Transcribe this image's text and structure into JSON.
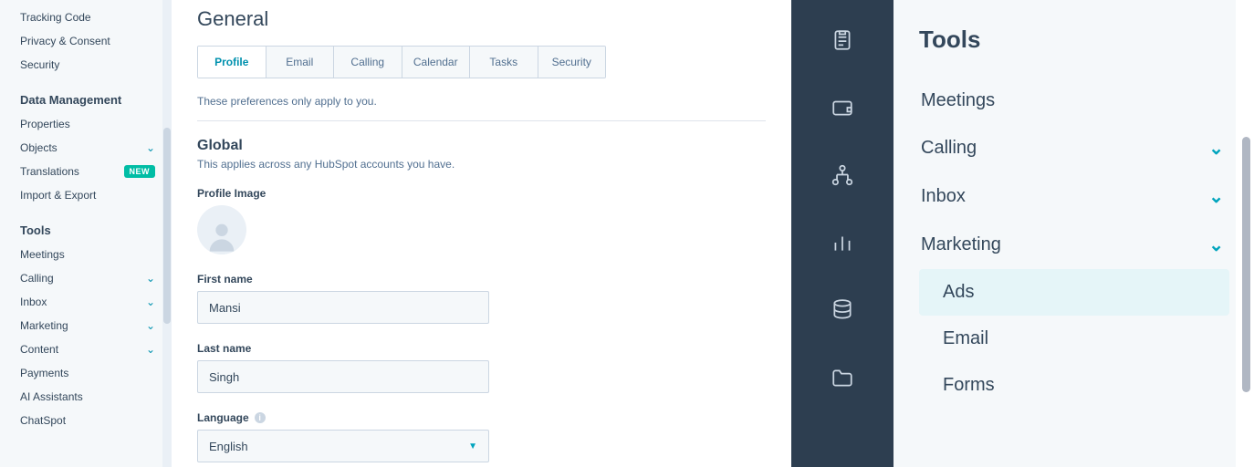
{
  "left": {
    "sidebar": {
      "top_links": [
        {
          "label": "Tracking Code"
        },
        {
          "label": "Privacy & Consent"
        },
        {
          "label": "Security"
        }
      ],
      "sections": [
        {
          "heading": "Data Management",
          "items": [
            {
              "label": "Properties"
            },
            {
              "label": "Objects",
              "chevron": true
            },
            {
              "label": "Translations",
              "badge": "NEW"
            },
            {
              "label": "Import & Export"
            }
          ]
        },
        {
          "heading": "Tools",
          "items": [
            {
              "label": "Meetings"
            },
            {
              "label": "Calling",
              "chevron": true
            },
            {
              "label": "Inbox",
              "chevron": true
            },
            {
              "label": "Marketing",
              "chevron": true
            },
            {
              "label": "Content",
              "chevron": true
            },
            {
              "label": "Payments"
            },
            {
              "label": "AI Assistants"
            },
            {
              "label": "ChatSpot"
            }
          ]
        }
      ]
    },
    "main": {
      "title": "General",
      "tabs": [
        "Profile",
        "Email",
        "Calling",
        "Calendar",
        "Tasks",
        "Security"
      ],
      "prefs_note": "These preferences only apply to you.",
      "global": {
        "title": "Global",
        "subtitle": "This applies across any HubSpot accounts you have.",
        "profile_image_label": "Profile Image",
        "first_name_label": "First name",
        "first_name_value": "Mansi",
        "last_name_label": "Last name",
        "last_name_value": "Singh",
        "language_label": "Language",
        "language_value": "English"
      }
    }
  },
  "right": {
    "title": "Tools",
    "items": [
      {
        "label": "Meetings"
      },
      {
        "label": "Calling",
        "chevron": true
      },
      {
        "label": "Inbox",
        "chevron": true
      },
      {
        "label": "Marketing",
        "chevron": true,
        "expanded": true,
        "children": [
          {
            "label": "Ads",
            "active": true
          },
          {
            "label": "Email"
          },
          {
            "label": "Forms"
          }
        ]
      }
    ]
  }
}
